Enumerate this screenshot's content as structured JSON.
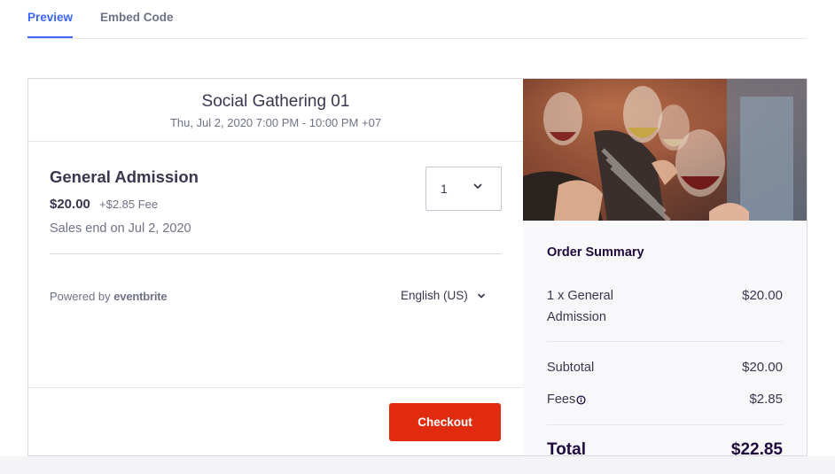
{
  "tabs": {
    "preview": "Preview",
    "embed": "Embed Code"
  },
  "event": {
    "title": "Social Gathering 01",
    "datetime": "Thu, Jul 2, 2020 7:00 PM - 10:00 PM +07"
  },
  "ticket": {
    "name": "General Admission",
    "price": "$20.00",
    "fee": "+$2.85 Fee",
    "sales_end": "Sales end on Jul 2, 2020",
    "quantity": "1"
  },
  "powered": {
    "prefix": "Powered by",
    "brand": "eventbrite"
  },
  "language": "English (US)",
  "checkout_label": "Checkout",
  "summary": {
    "title": "Order Summary",
    "line_label": "1 x General Admission",
    "line_amount": "$20.00",
    "subtotal_label": "Subtotal",
    "subtotal_amount": "$20.00",
    "fees_label": "Fees",
    "fees_amount": "$2.85",
    "total_label": "Total",
    "total_amount": "$22.85"
  },
  "colors": {
    "accent": "#3d64ff",
    "checkout": "#e02b0e",
    "text": "#39364f",
    "muted": "#6f7287"
  },
  "icons": [
    "chevron-down-icon",
    "info-icon"
  ]
}
